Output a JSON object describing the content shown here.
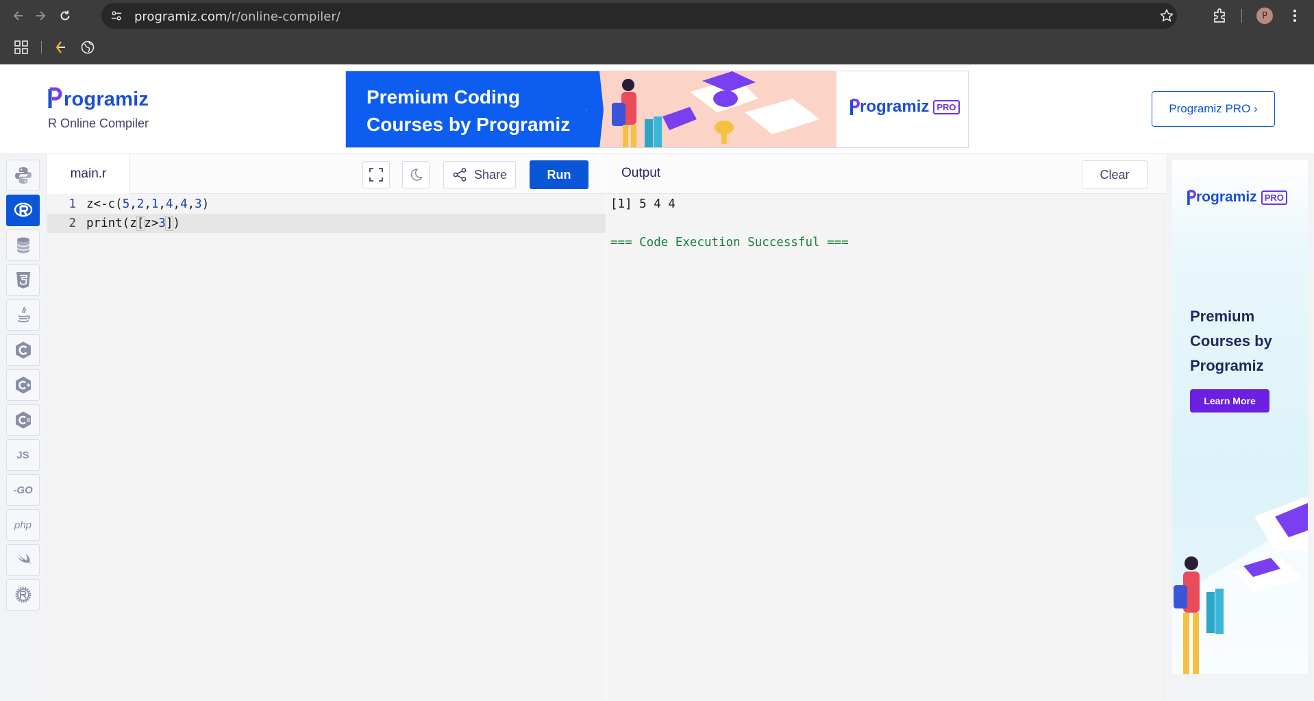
{
  "browser": {
    "url_domain": "programiz.com",
    "url_path": "/r/online-compiler/",
    "profile_initial": "P"
  },
  "header": {
    "logo_text": "rogramiz",
    "subtitle": "R Online Compiler",
    "banner_title": "Premium Coding Courses by Programiz",
    "banner_logo_text": "rogramiz",
    "banner_badge": "PRO",
    "pro_button_label": "Programiz PRO ›"
  },
  "sidebar": {
    "languages": [
      {
        "name": "Python",
        "icon": "python-icon",
        "active": false
      },
      {
        "name": "R",
        "icon": "r-icon",
        "active": true
      },
      {
        "name": "SQL",
        "icon": "database-icon",
        "active": false
      },
      {
        "name": "HTML",
        "icon": "html5-icon",
        "active": false
      },
      {
        "name": "Java",
        "icon": "java-icon",
        "active": false
      },
      {
        "name": "C",
        "icon": "c-icon",
        "active": false
      },
      {
        "name": "C++",
        "icon": "cpp-icon",
        "active": false
      },
      {
        "name": "C#",
        "icon": "csharp-icon",
        "active": false
      },
      {
        "name": "JavaScript",
        "icon": "js-icon",
        "label": "JS",
        "active": false
      },
      {
        "name": "Go",
        "icon": "go-icon",
        "label": "-GO",
        "active": false
      },
      {
        "name": "PHP",
        "icon": "php-icon",
        "label": "php",
        "active": false
      },
      {
        "name": "Swift",
        "icon": "swift-icon",
        "active": false
      },
      {
        "name": "Rust",
        "icon": "rust-icon",
        "active": false
      }
    ]
  },
  "editor": {
    "file_name": "main.r",
    "share_label": "Share",
    "run_label": "Run",
    "lines": [
      {
        "number": "1",
        "text": "z<-c(5,2,1,4,4,3)"
      },
      {
        "number": "2",
        "text": "print(z[z>3])"
      }
    ]
  },
  "output": {
    "title": "Output",
    "clear_label": "Clear",
    "lines": [
      "[1] 5 4 4",
      "",
      "=== Code Execution Successful ==="
    ]
  },
  "right_ad": {
    "logo_text": "rogramiz",
    "badge": "PRO",
    "heading": "Premium Courses by Programiz",
    "button_label": "Learn More"
  },
  "colors": {
    "primary": "#0b56d6",
    "brand_purple": "#6b34e0",
    "success": "#1a7f37"
  }
}
